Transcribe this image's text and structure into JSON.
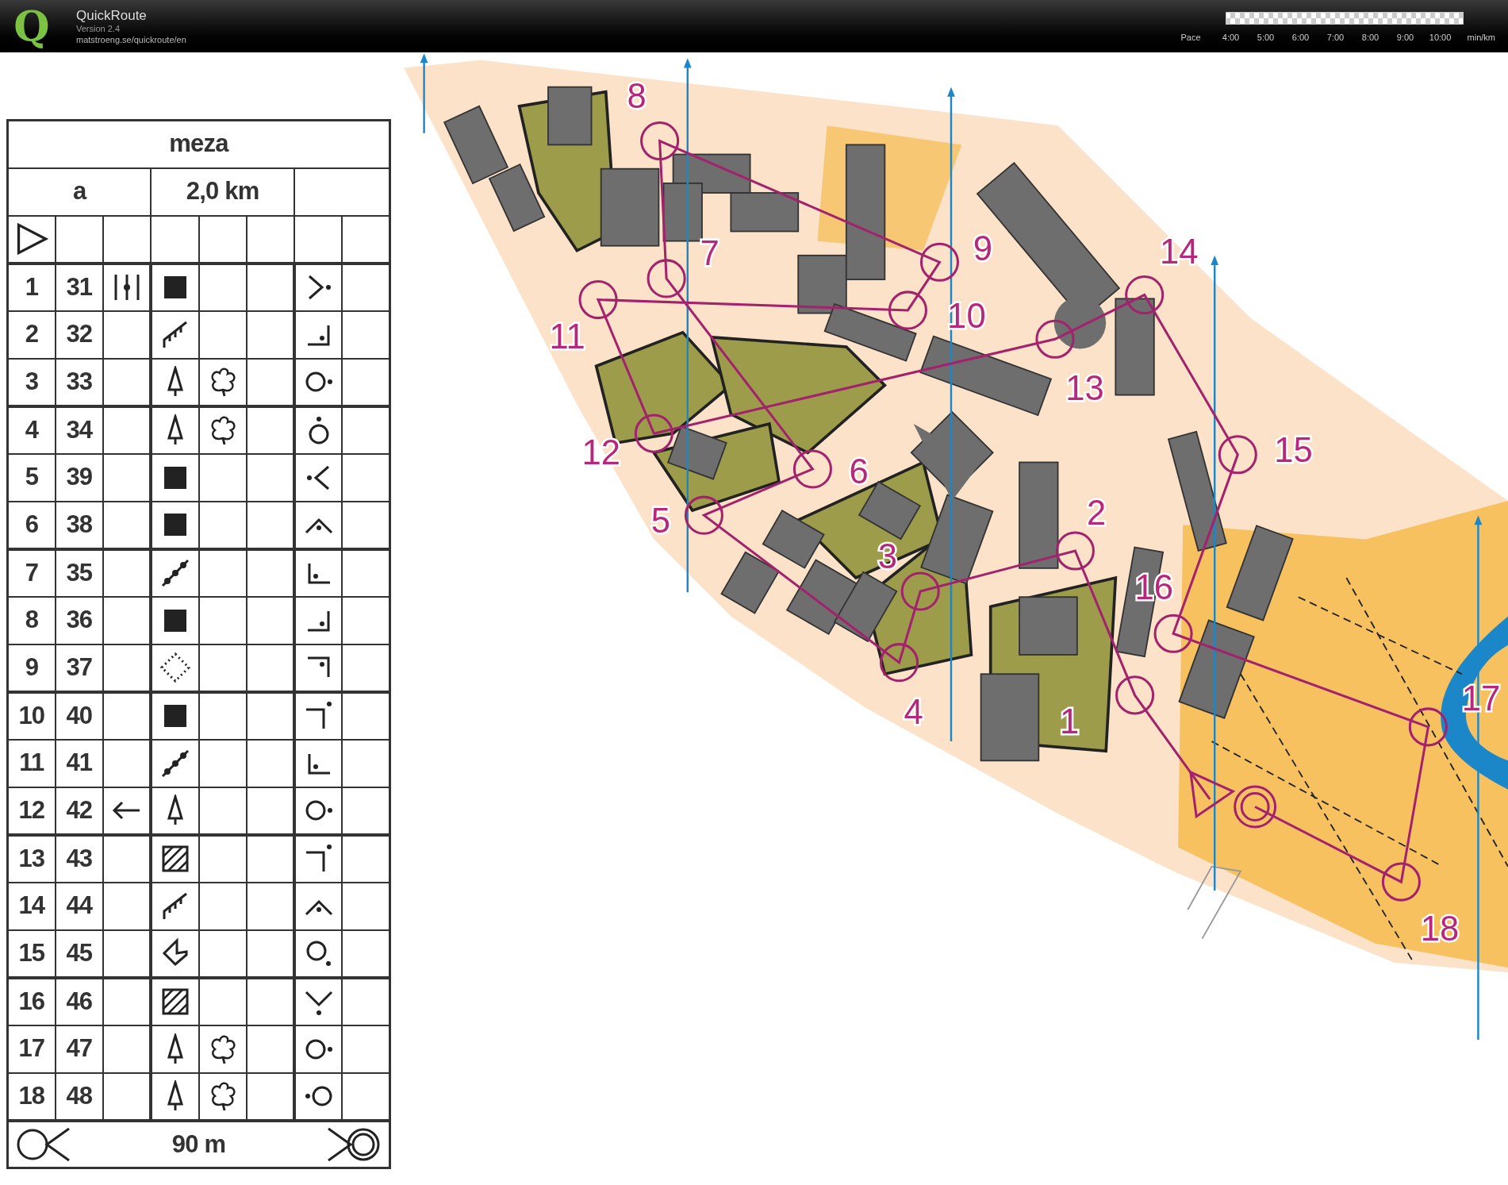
{
  "header": {
    "logo_letter": "Q",
    "app_name": "QuickRoute",
    "version": "Version 2.4",
    "url": "matstroeng.se/quickroute/en",
    "pace": {
      "label": "Pace",
      "ticks": [
        "4:00",
        "5:00",
        "6:00",
        "7:00",
        "8:00",
        "9:00",
        "10:00"
      ],
      "unit": "min/km"
    }
  },
  "description_sheet": {
    "title": "meza",
    "course": "a",
    "length": "2,0 km",
    "rows": [
      {
        "number": "1",
        "code": "31"
      },
      {
        "number": "2",
        "code": "32"
      },
      {
        "number": "3",
        "code": "33"
      },
      {
        "number": "4",
        "code": "34"
      },
      {
        "number": "5",
        "code": "39"
      },
      {
        "number": "6",
        "code": "38"
      },
      {
        "number": "7",
        "code": "35"
      },
      {
        "number": "8",
        "code": "36"
      },
      {
        "number": "9",
        "code": "37"
      },
      {
        "number": "10",
        "code": "40"
      },
      {
        "number": "11",
        "code": "41"
      },
      {
        "number": "12",
        "code": "42"
      },
      {
        "number": "13",
        "code": "43"
      },
      {
        "number": "14",
        "code": "44"
      },
      {
        "number": "15",
        "code": "45"
      },
      {
        "number": "16",
        "code": "46"
      },
      {
        "number": "17",
        "code": "47"
      },
      {
        "number": "18",
        "code": "48"
      }
    ],
    "finish_distance": "90 m"
  },
  "map": {
    "controls": [
      {
        "label": "1"
      },
      {
        "label": "2"
      },
      {
        "label": "3"
      },
      {
        "label": "4"
      },
      {
        "label": "5"
      },
      {
        "label": "6"
      },
      {
        "label": "7"
      },
      {
        "label": "8"
      },
      {
        "label": "9"
      },
      {
        "label": "10"
      },
      {
        "label": "11"
      },
      {
        "label": "12"
      },
      {
        "label": "13"
      },
      {
        "label": "14"
      },
      {
        "label": "15"
      },
      {
        "label": "16"
      },
      {
        "label": "17"
      },
      {
        "label": "18"
      }
    ]
  }
}
